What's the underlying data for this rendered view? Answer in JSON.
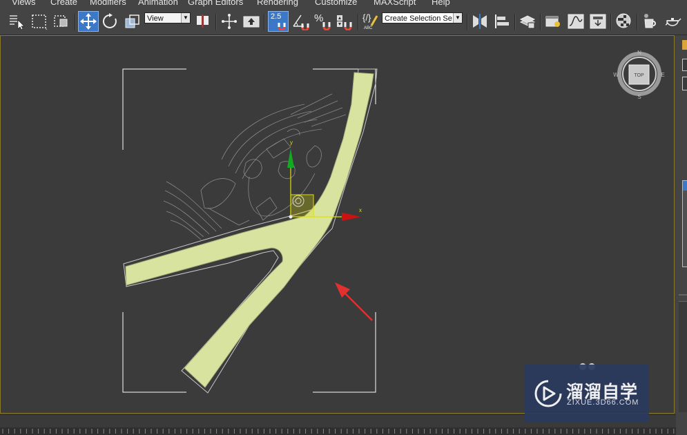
{
  "menu": {
    "items": [
      "Views",
      "Create",
      "Modifiers",
      "Animation",
      "Graph Editors",
      "Rendering",
      "Customize",
      "MAXScript",
      "Help"
    ]
  },
  "toolbar": {
    "ref_coord_dropdown": "View",
    "snap_toggle_label": "2.5",
    "percent_snap_label": "%",
    "edit_named_selection_label": "{/}",
    "edit_named_selection_caption": "ABC",
    "named_selection_dropdown": "Create Selection Se"
  },
  "viewport": {
    "name": "Top",
    "viewcube": {
      "face_label": "TOP",
      "compass": {
        "n": "N",
        "s": "S",
        "e": "E",
        "w": "W"
      }
    },
    "gizmo": {
      "x_label": "x",
      "y_label": "y"
    },
    "colors": {
      "road_fill": "#d9e3a0",
      "gizmo_x": "#cc1111",
      "gizmo_y": "#11aa22",
      "gizmo_plane": "#e0e000",
      "annotation_arrow": "#e03030"
    }
  },
  "watermark": {
    "title": "溜溜自学",
    "url": "ZIXUE.3D66.COM"
  }
}
